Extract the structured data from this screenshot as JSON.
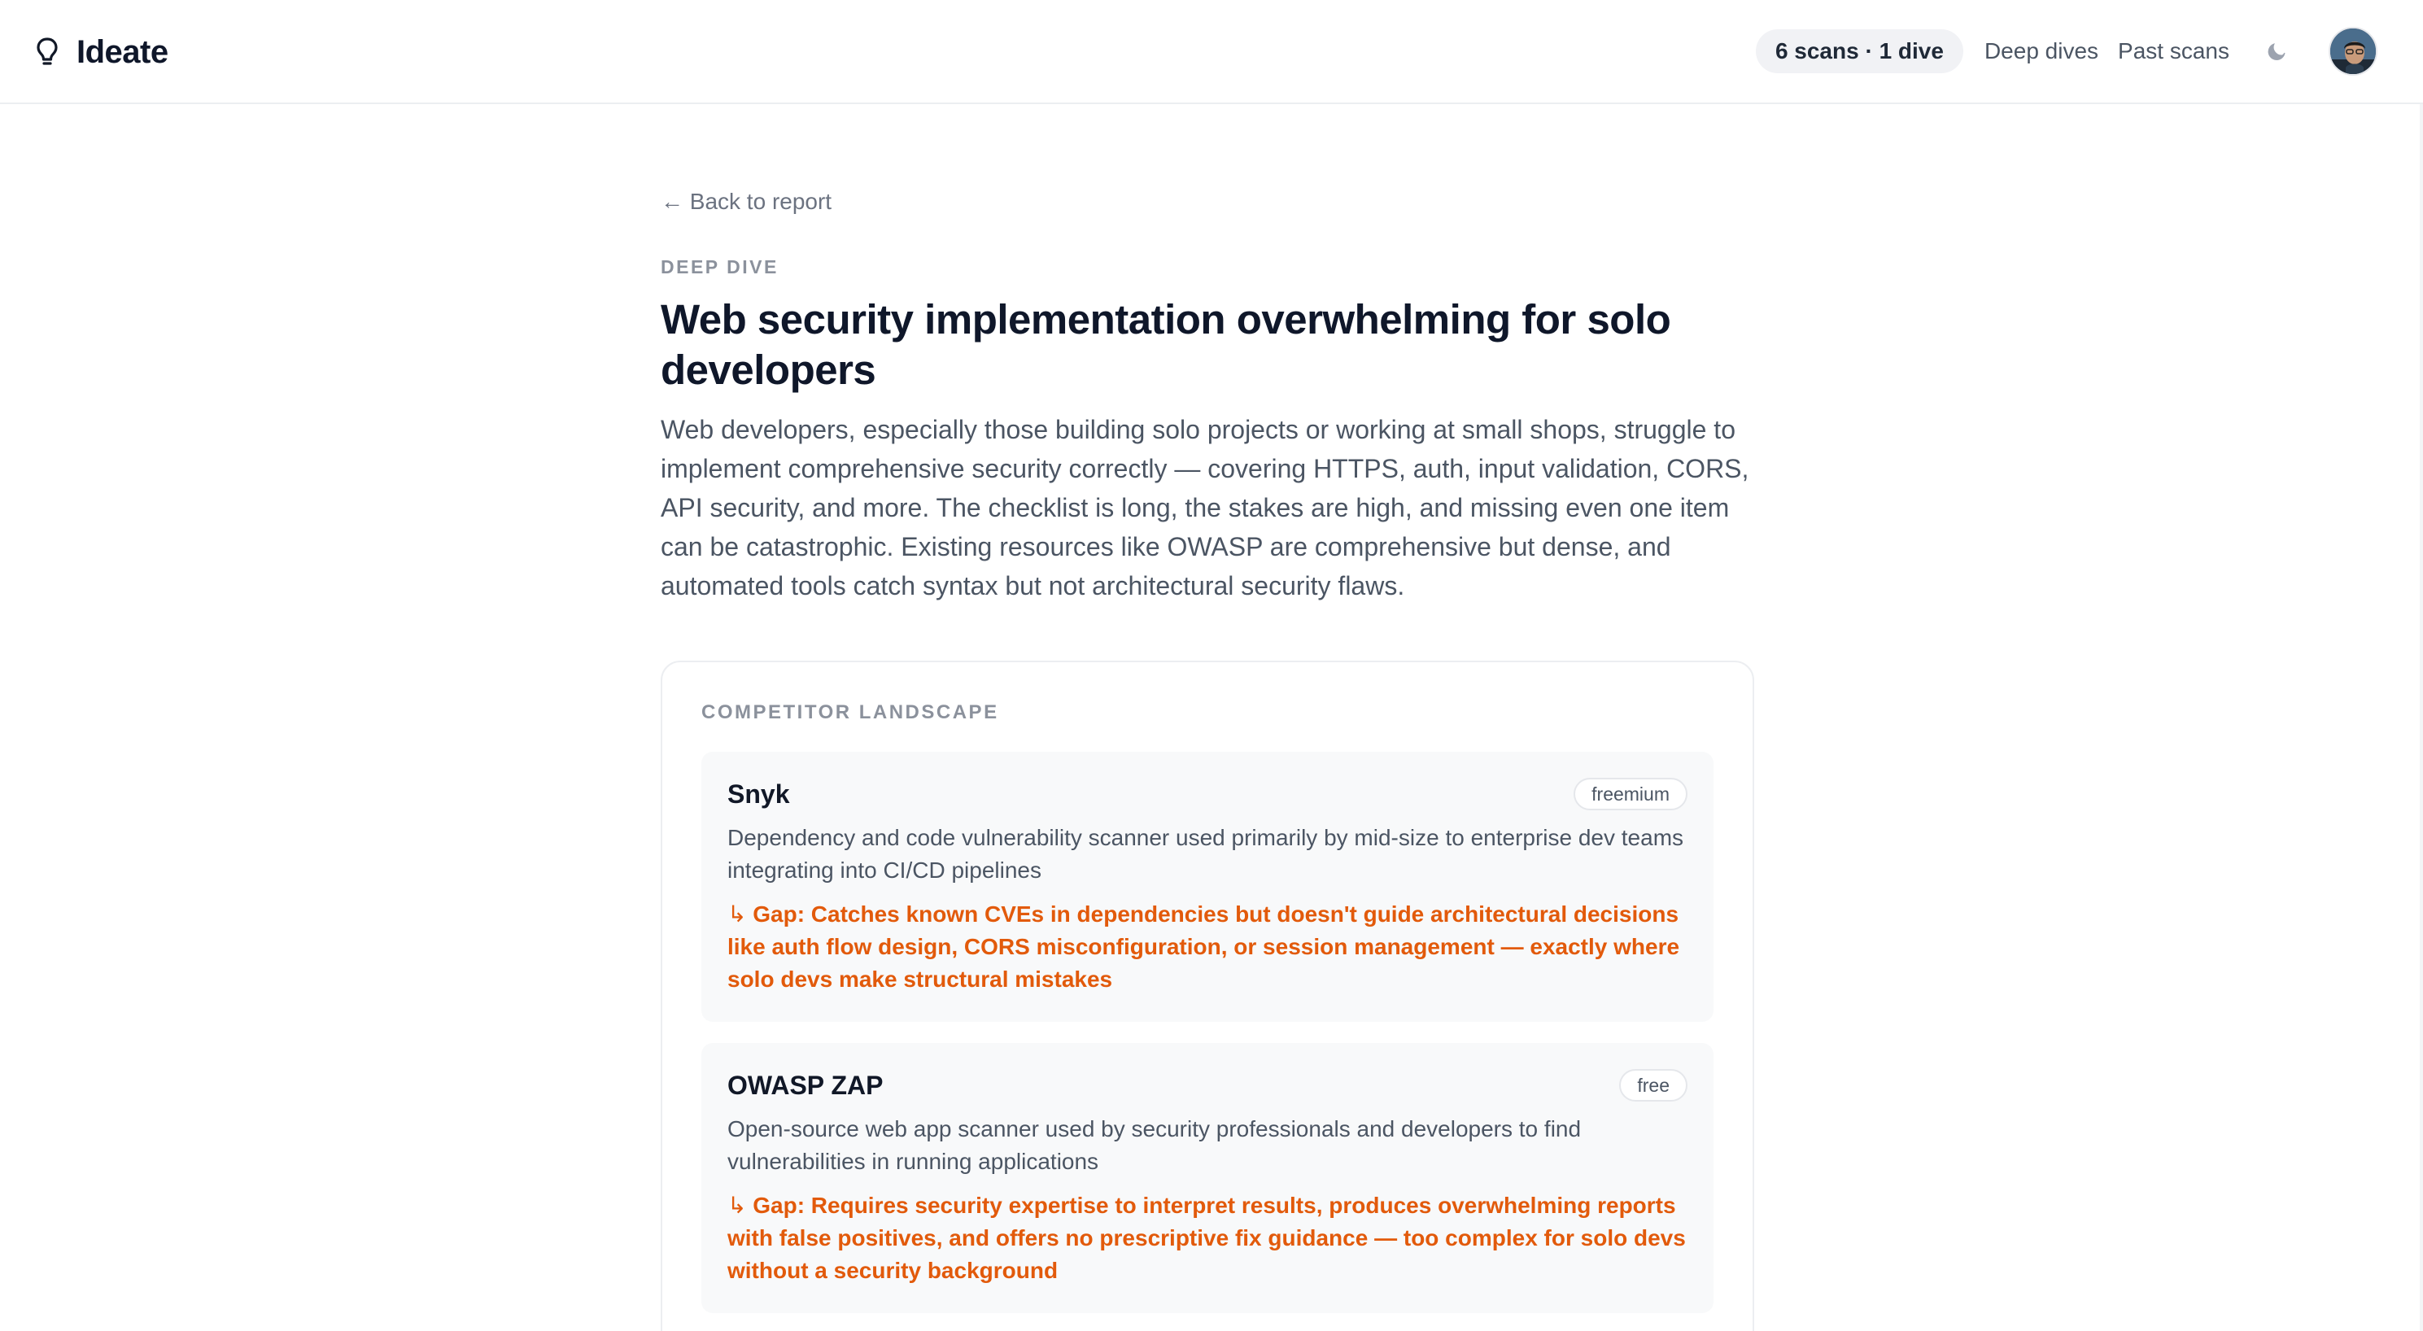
{
  "header": {
    "brand": "Ideate",
    "brand_icon": "lightbulb-icon",
    "usage": "6 scans · 1 dive",
    "nav": [
      "Deep dives",
      "Past scans"
    ],
    "theme_toggle_icon": "moon-icon"
  },
  "page": {
    "back_link": "← Back to report",
    "eyebrow": "DEEP DIVE",
    "title": "Web security implementation overwhelming for solo developers",
    "description": "Web developers, especially those building solo projects or working at small shops, struggle to implement comprehensive security correctly — covering HTTPS, auth, input validation, CORS, API security, and more. The checklist is long, the stakes are high, and missing even one item can be catastrophic. Existing resources like OWASP are comprehensive but dense, and automated tools catch syntax but not architectural security flaws."
  },
  "competitors": {
    "section_title": "COMPETITOR LANDSCAPE",
    "items": [
      {
        "name": "Snyk",
        "pricing": "freemium",
        "description": "Dependency and code vulnerability scanner used primarily by mid-size to enterprise dev teams integrating into CI/CD pipelines",
        "gap_arrow": "↳",
        "gap": "Gap: Catches known CVEs in dependencies but doesn't guide architectural decisions like auth flow design, CORS misconfiguration, or session management — exactly where solo devs make structural mistakes"
      },
      {
        "name": "OWASP ZAP",
        "pricing": "free",
        "description": "Open-source web app scanner used by security professionals and developers to find vulnerabilities in running applications",
        "gap_arrow": "↳",
        "gap": "Gap: Requires security expertise to interpret results, produces overwhelming reports with false positives, and offers no prescriptive fix guidance — too complex for solo devs without a security background"
      }
    ]
  },
  "colors": {
    "accent_gap": "#e25a0b",
    "text_primary": "#0f172a",
    "text_muted": "#4b5563"
  }
}
